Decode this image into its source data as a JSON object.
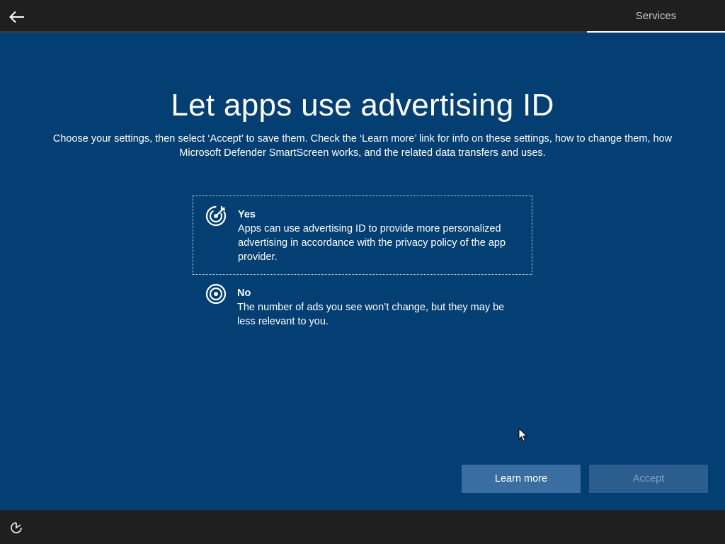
{
  "header": {
    "back_icon": "back-arrow-icon",
    "section_label": "Services"
  },
  "main": {
    "title": "Let apps use advertising ID",
    "subtitle": "Choose your settings, then select ‘Accept’ to save them. Check the ‘Learn more’ link for info on these settings, how to change them, how Microsoft Defender SmartScreen works, and the related data transfers and uses.",
    "options": [
      {
        "title": "Yes",
        "description": "Apps can use advertising ID to provide more personalized advertising in accordance with the privacy policy of the app provider.",
        "icon": "target-arrow-icon",
        "selected": true
      },
      {
        "title": "No",
        "description": "The number of ads you see won’t change, but they may be less relevant to you.",
        "icon": "target-icon",
        "selected": false
      }
    ]
  },
  "buttons": {
    "learn_more": "Learn more",
    "accept": "Accept",
    "accept_enabled": false
  },
  "footer": {
    "accessibility_icon": "ease-of-access-icon"
  },
  "colors": {
    "background": "#033f72",
    "bar": "#1f1f1f",
    "button": "#3a6ea3",
    "button_disabled": "#2c5d8f"
  }
}
